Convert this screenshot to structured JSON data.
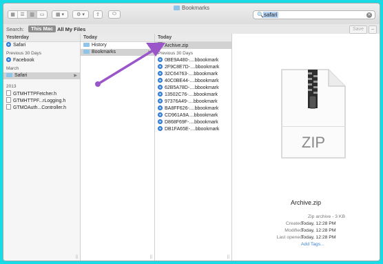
{
  "window": {
    "title": "Bookmarks"
  },
  "toolbar": {
    "views": [
      {
        "icon": "icon-view-icon",
        "glyph": "▦"
      },
      {
        "icon": "list-view-icon",
        "glyph": "☰"
      },
      {
        "icon": "column-view-icon",
        "glyph": "▥"
      },
      {
        "icon": "coverflow-view-icon",
        "glyph": "▭"
      }
    ],
    "arrange_glyph": "▦ ▾",
    "action_glyph": "⚙ ▾",
    "share_glyph": "⇪",
    "tag_glyph": "⬭"
  },
  "search": {
    "value": "safari",
    "icon_glyph": "🔍",
    "clear_glyph": "✕"
  },
  "scope": {
    "label": "Search:",
    "this_mac": "This Mac",
    "all_files": "All My Files",
    "save": "Save",
    "minus": "−"
  },
  "col1": {
    "sections": [
      {
        "title": "Yesterday",
        "items": [
          {
            "label": "Safari",
            "icon": "safari-compass-icon",
            "selected": false
          }
        ]
      },
      {
        "title": "Previous 30 Days",
        "items": [
          {
            "label": "Facebook",
            "icon": "safari-compass-icon",
            "selected": false
          }
        ]
      },
      {
        "title": "March",
        "items": [
          {
            "label": "Safari",
            "icon": "folder-icon",
            "selected": true
          }
        ]
      },
      {
        "title": "2013",
        "items": [
          {
            "label": "GTMHTTPFetcher.h",
            "icon": "document-icon",
            "selected": false
          },
          {
            "label": "GTMHTTPF...rLogging.h",
            "icon": "document-icon",
            "selected": false
          },
          {
            "label": "GTMOAuth...Controller.h",
            "icon": "document-icon",
            "selected": false
          }
        ]
      }
    ]
  },
  "col2": {
    "header": "Today",
    "items": [
      {
        "label": "History",
        "selected": false
      },
      {
        "label": "Bookmarks",
        "selected": true
      }
    ]
  },
  "col3": {
    "header": "Today",
    "zip_item": "Archive.zip",
    "section": "Previous 30 Days",
    "items": [
      "0BE9A480-....bbookmark",
      "2F9C8E7D-....bbookmark",
      "32C64763-....bbookmark",
      "40C0BE44-....bbookmark",
      "62B5A78D-....bbookmark",
      "13502C76-....bbookmark",
      "97376A49-....bbookmark",
      "BA8FF626-....bbookmark",
      "CD961A9A....bbookmark",
      "D868F69F-....bbookmark",
      "DB1FA65E-....bbookmark"
    ]
  },
  "preview": {
    "icon_label": "ZIP",
    "filename": "Archive.zip",
    "kind": "Zip archive - 3 KB",
    "created_label": "Created",
    "created_value": "Today, 12:28 PM",
    "modified_label": "Modified",
    "modified_value": "Today, 12:28 PM",
    "opened_label": "Last opened",
    "opened_value": "Today, 12:28 PM",
    "add_tags": "Add Tags..."
  },
  "colors": {
    "background": "#19dbe6",
    "annotation_arrow": "#9a55c8"
  }
}
